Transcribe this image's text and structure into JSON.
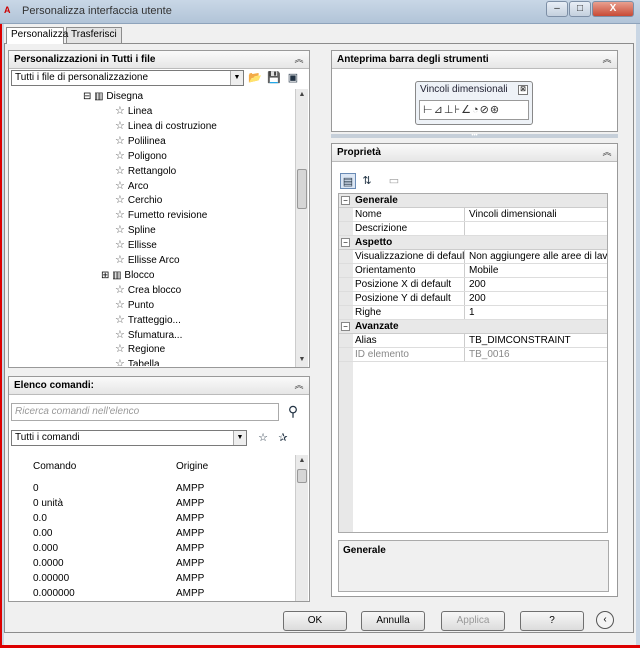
{
  "window": {
    "title": "Personalizza interfaccia utente",
    "app_icon": "A",
    "min": "–",
    "max": "□",
    "close": "X"
  },
  "tabs": [
    "Personalizza",
    "Trasferisci"
  ],
  "customizations": {
    "title": "Personalizzazioni in Tutti i file",
    "combo": "Tutti i file di personalizzazione",
    "tree_parent": "Disegna",
    "tree_items": [
      "Linea",
      "Linea di costruzione",
      "Polilinea",
      "Poligono",
      "Rettangolo",
      "Arco",
      "Cerchio",
      "Fumetto revisione",
      "Spline",
      "Ellisse",
      "Ellisse Arco",
      "Blocco",
      "Crea blocco",
      "Punto",
      "Tratteggio...",
      "Sfumatura...",
      "Regione",
      "Tabella"
    ]
  },
  "commands": {
    "title": "Elenco comandi:",
    "search_placeholder": "Ricerca comandi nell'elenco",
    "combo": "Tutti i comandi",
    "col_command": "Comando",
    "col_origin": "Origine",
    "rows": [
      {
        "cmd": "0",
        "orig": "AMPP"
      },
      {
        "cmd": "0 unità",
        "orig": "AMPP"
      },
      {
        "cmd": "0.0",
        "orig": "AMPP"
      },
      {
        "cmd": "0.00",
        "orig": "AMPP"
      },
      {
        "cmd": "0.000",
        "orig": "AMPP"
      },
      {
        "cmd": "0.0000",
        "orig": "AMPP"
      },
      {
        "cmd": "0.00000",
        "orig": "AMPP"
      },
      {
        "cmd": "0.000000",
        "orig": "AMPP"
      }
    ]
  },
  "preview": {
    "title": "Anteprima barra degli strumenti",
    "toolbar_name": "Vincoli dimensionali"
  },
  "properties": {
    "title": "Proprietà",
    "sections": [
      {
        "name": "Generale",
        "rows": [
          {
            "k": "Nome",
            "v": "Vincoli dimensionali"
          },
          {
            "k": "Descrizione",
            "v": ""
          }
        ]
      },
      {
        "name": "Aspetto",
        "rows": [
          {
            "k": "Visualizzazione di default",
            "v": "Non aggiungere alle aree di lavoro"
          },
          {
            "k": "Orientamento",
            "v": "Mobile"
          },
          {
            "k": "Posizione X di default",
            "v": "200"
          },
          {
            "k": "Posizione Y di default",
            "v": "200"
          },
          {
            "k": "Righe",
            "v": "1"
          }
        ]
      },
      {
        "name": "Avanzate",
        "rows": [
          {
            "k": "Alias",
            "v": "TB_DIMCONSTRAINT"
          },
          {
            "k": "ID elemento",
            "v": "TB_0016"
          }
        ]
      }
    ],
    "description_title": "Generale"
  },
  "buttons": {
    "ok": "OK",
    "cancel": "Annulla",
    "apply": "Applica",
    "help": "?"
  }
}
